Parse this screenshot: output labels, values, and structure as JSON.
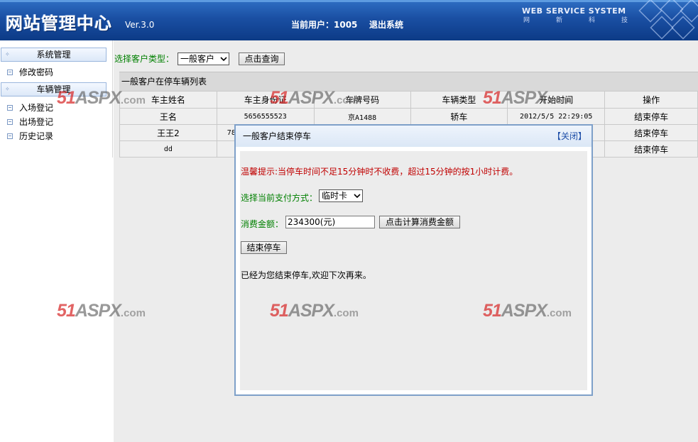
{
  "header": {
    "title": "网站管理中心",
    "version": "Ver.3.0",
    "current_user": "当前用户：1005",
    "logout": "退出系统",
    "brand": "WEB SERVICE SYSTEM",
    "brand_sub": [
      "网",
      "新",
      "科",
      "技"
    ]
  },
  "sidebar": {
    "sections": [
      {
        "title": "系统管理",
        "items": [
          "修改密码"
        ]
      },
      {
        "title": "车辆管理",
        "items": [
          "入场登记",
          "出场登记",
          "历史记录"
        ]
      }
    ]
  },
  "filter": {
    "label": "选择客户类型：",
    "selected": "一般客户",
    "button": "点击查询"
  },
  "list": {
    "title": "一般客户在停车辆列表",
    "columns": [
      "车主姓名",
      "车主身份证",
      "车牌号码",
      "车辆类型",
      "开始时间",
      "操作"
    ],
    "rows": [
      {
        "name": "王名",
        "id_card": "5656555523",
        "plate": "京A1488",
        "type": "轿车",
        "start": "2012/5/5 22:29:05",
        "action": "结束停车"
      },
      {
        "name": "王王2",
        "id_card": "78",
        "plate": "",
        "type": "",
        "start": "",
        "action": "结束停车"
      },
      {
        "name": "dd",
        "id_card": "",
        "plate": "",
        "type": "",
        "start": "",
        "action": "结束停车"
      }
    ]
  },
  "watermark": {
    "main": "51",
    "asp": "ASPX",
    "com": ".com"
  },
  "dialog": {
    "title": "一般客户结束停车",
    "close": "【关闭】",
    "tip": "温馨提示:当停车时间不足15分钟时不收费，超过15分钟的按1小时计费。",
    "pay_label": "选择当前支付方式：",
    "pay_selected": "临时卡",
    "amount_label": "消费金额：",
    "amount_value": "234300(元)",
    "calc_button": "点击计算消费金额",
    "end_button": "结束停车",
    "message": "已经为您结束停车,欢迎下次再来。"
  },
  "colors": {
    "header": "#1a4fa3",
    "label_green": "#008000",
    "tip_red": "#c00000",
    "link_blue": "#1f4fa8"
  }
}
